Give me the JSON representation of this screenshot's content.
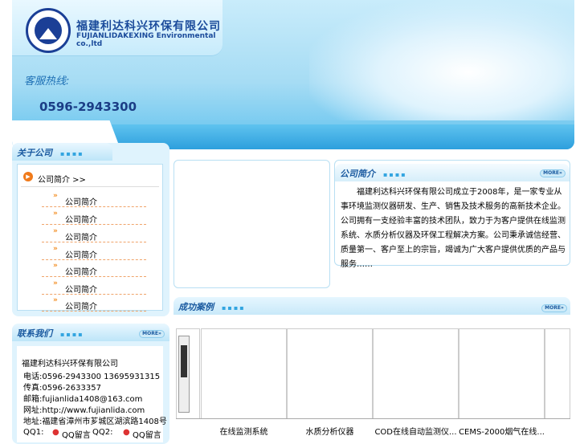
{
  "header": {
    "company_cn": "福建利达科兴环保有限公司",
    "company_en": "FUJIANLIDAKEXING Environmental co.,ltd",
    "hotline_label": "客服热线:",
    "hotline_number": "0596-2943300"
  },
  "about": {
    "title": "关于公司",
    "dots": "▪▪▪▪",
    "intro_link": "公司简介 >>",
    "items": [
      "公司简介",
      "公司简介",
      "公司简介",
      "公司简介",
      "公司简介",
      "公司简介",
      "公司简介"
    ]
  },
  "contact": {
    "title": "联系我们",
    "dots": "▪▪▪▪",
    "more": "MORE»",
    "company": "福建利达科兴环保有限公司",
    "phone": "电话:0596-2943300 13695931315",
    "fax": "传真:0596-2633357",
    "email": "邮箱:fujianlida1408@163.com",
    "web": "网址:http://www.fujianlida.com",
    "address": "地址:福建省漳州市芗城区湖滨路1408号",
    "qq1": "QQ1:",
    "qq1_msg": "QQ留言",
    "qq2": "QQ2:",
    "qq2_msg": "QQ留言"
  },
  "profile": {
    "title": "公司简介",
    "dots": "▪▪▪▪",
    "more": "MORE»",
    "text": "福建利达科兴环保有限公司成立于2008年，是一家专业从事环境监测仪器研发、生产、销售及技术服务的高新技术企业。公司拥有一支经验丰富的技术团队，致力于为客户提供在线监测系统、水质分析仪器及环保工程解决方案。公司秉承诚信经营、质量第一、客户至上的宗旨，竭诚为广大客户提供优质的产品与服务……"
  },
  "cases": {
    "title": "成功案例",
    "dots": "▪▪▪▪",
    "more": "MORE»",
    "captions": [
      "在线监测系统",
      "水质分析仪器",
      "COD在线自动监测仪...",
      "CEMS-2000烟气在线..."
    ]
  }
}
